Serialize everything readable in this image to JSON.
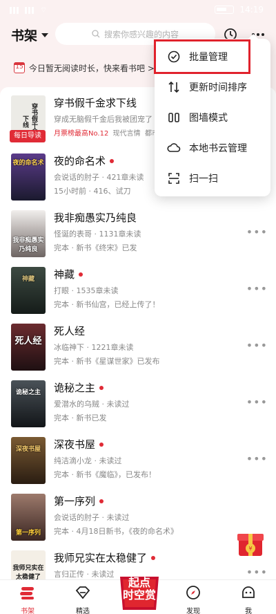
{
  "status": {
    "time": "14:19",
    "battery": ""
  },
  "header": {
    "title": "书架",
    "search_placeholder": "搜索你感兴趣的内容"
  },
  "tip": {
    "calendar_day": "15",
    "text": "今日暂无阅读时长，快来看书吧 >"
  },
  "menu": {
    "items": [
      {
        "label": "批量管理",
        "icon": "check-circle-icon"
      },
      {
        "label": "更新时间排序",
        "icon": "sort-icon"
      },
      {
        "label": "图墙模式",
        "icon": "grid-icon"
      },
      {
        "label": "本地书云管理",
        "icon": "cloud-icon"
      },
      {
        "label": "扫一扫",
        "icon": "scan-icon"
      }
    ]
  },
  "books": [
    {
      "title": "穿书假千金求下线",
      "line1": "穿成无脑假千金后我被团宠了",
      "line2": "月票榜最高No.12  现代言情  都市",
      "cover_text": "穿书假千金求下线",
      "cover_color": "#ecebe6",
      "tag": "每日导读",
      "dot": false
    },
    {
      "title": "夜的命名术",
      "line1": "会说话的肘子 · 421章未读",
      "line2": "15小时前 · 416、试刀",
      "cover_text": "夜的命名术",
      "cover_color": "#2a2440",
      "dot": true
    },
    {
      "title": "我非痴愚实乃纯良",
      "line1": "怪诞的表哥 · 1131章未读",
      "line2": "完本 · 新书《终宋》已发",
      "cover_text": "我非痴愚实乃纯良",
      "cover_color": "#d8d4d2",
      "dot": false
    },
    {
      "title": "神藏",
      "line1": "打眼 · 1535章未读",
      "line2": "完本 · 新书仙宫，已经上传了！",
      "cover_text": "神藏",
      "cover_color": "#1f2a26",
      "dot": true
    },
    {
      "title": "死人经",
      "line1": "冰临神下 · 1221章未读",
      "line2": "完本 · 新书《星谋世家》已发布",
      "cover_text": "死人经",
      "cover_color": "#3a1f22",
      "dot": false
    },
    {
      "title": "诡秘之主",
      "line1": "爱潜水的乌贼 · 未读过",
      "line2": "完本 · 新书已发",
      "cover_text": "诡秘之主",
      "cover_color": "#20262a",
      "dot": true
    },
    {
      "title": "深夜书屋",
      "line1": "纯洁滴小龙 · 未读过",
      "line2": "完本 · 新书《魔临》，已发布！",
      "cover_text": "深夜书屋",
      "cover_color": "#3b2a1b",
      "dot": true
    },
    {
      "title": "第一序列",
      "line1": "会说话的肘子 · 未读过",
      "line2": "完本 · 4月18日新书，《夜的命名术》",
      "cover_text": "第一序列",
      "cover_color": "#5a3a35",
      "dot": true
    },
    {
      "title": "我师兄实在太稳健了",
      "line1": "言归正传 · 未读过",
      "line2": "",
      "cover_text": "我师兄实在太稳健了",
      "cover_color": "#f4efe6",
      "dot": true
    }
  ],
  "tabs": [
    {
      "label": "书架",
      "icon": "bookshelf-icon",
      "active": true
    },
    {
      "label": "精选",
      "icon": "diamond-icon",
      "active": false
    },
    {
      "label": "发现",
      "icon": "compass-icon",
      "active": false
    },
    {
      "label": "我",
      "icon": "face-icon",
      "active": false
    }
  ],
  "promo_text": [
    "起点",
    "时空赏"
  ],
  "colors": {
    "accent": "#e02b36",
    "background": "#fbf1f1"
  }
}
